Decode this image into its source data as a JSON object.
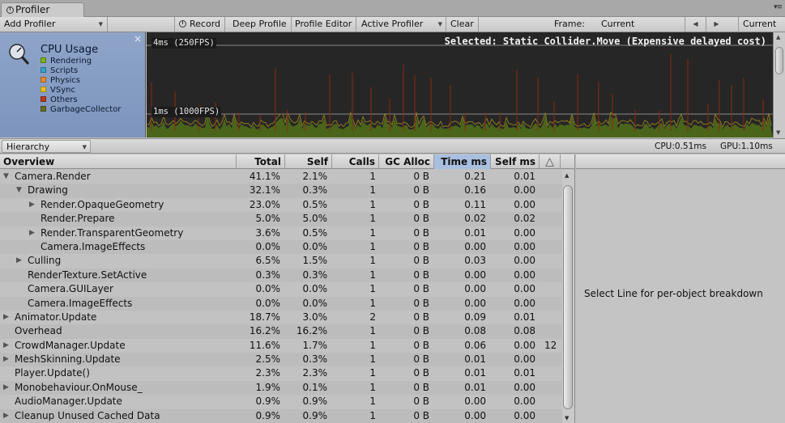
{
  "window": {
    "tab_title": "Profiler"
  },
  "toolbar": {
    "add_profiler": "Add Profiler",
    "record": "Record",
    "deep_profile": "Deep Profile",
    "profile_editor": "Profile Editor",
    "active_profiler": "Active Profiler",
    "clear": "Clear",
    "frame_label": "Frame:",
    "frame_value": "Current",
    "current_button": "Current"
  },
  "graph": {
    "area_title": "CPU Usage",
    "legend": [
      {
        "name": "Rendering",
        "color": "#7ab317"
      },
      {
        "name": "Scripts",
        "color": "#3aa1c7"
      },
      {
        "name": "Physics",
        "color": "#e88a2f"
      },
      {
        "name": "VSync",
        "color": "#e6c21e"
      },
      {
        "name": "Others",
        "color": "#b83b1a"
      },
      {
        "name": "GarbageCollector",
        "color": "#6b6b22"
      }
    ],
    "label_top": "4ms (250FPS)",
    "label_bottom": "1ms (1000FPS)",
    "selected": "Selected: Static Collider.Move (Expensive delayed cost)"
  },
  "hierarchy": {
    "mode": "Hierarchy",
    "cpu": "CPU:0.51ms",
    "gpu": "GPU:1.10ms"
  },
  "table": {
    "headers": {
      "overview": "Overview",
      "total": "Total",
      "self": "Self",
      "calls": "Calls",
      "gc_alloc": "GC Alloc",
      "time_ms": "Time ms",
      "self_ms": "Self ms"
    },
    "rows": [
      {
        "name": "Camera.Render",
        "depth": 0,
        "expander": "open",
        "total": "41.1%",
        "self": "2.1%",
        "calls": "1",
        "gc": "0 B",
        "time": "0.21",
        "selfms": "0.01",
        "warn": ""
      },
      {
        "name": "Drawing",
        "depth": 1,
        "expander": "open",
        "total": "32.1%",
        "self": "0.3%",
        "calls": "1",
        "gc": "0 B",
        "time": "0.16",
        "selfms": "0.00",
        "warn": ""
      },
      {
        "name": "Render.OpaqueGeometry",
        "depth": 2,
        "expander": "closed",
        "total": "23.0%",
        "self": "0.5%",
        "calls": "1",
        "gc": "0 B",
        "time": "0.11",
        "selfms": "0.00",
        "warn": ""
      },
      {
        "name": "Render.Prepare",
        "depth": 2,
        "expander": "none",
        "total": "5.0%",
        "self": "5.0%",
        "calls": "1",
        "gc": "0 B",
        "time": "0.02",
        "selfms": "0.02",
        "warn": ""
      },
      {
        "name": "Render.TransparentGeometry",
        "depth": 2,
        "expander": "closed",
        "total": "3.6%",
        "self": "0.5%",
        "calls": "1",
        "gc": "0 B",
        "time": "0.01",
        "selfms": "0.00",
        "warn": ""
      },
      {
        "name": "Camera.ImageEffects",
        "depth": 2,
        "expander": "none",
        "total": "0.0%",
        "self": "0.0%",
        "calls": "1",
        "gc": "0 B",
        "time": "0.00",
        "selfms": "0.00",
        "warn": ""
      },
      {
        "name": "Culling",
        "depth": 1,
        "expander": "closed",
        "total": "6.5%",
        "self": "1.5%",
        "calls": "1",
        "gc": "0 B",
        "time": "0.03",
        "selfms": "0.00",
        "warn": ""
      },
      {
        "name": "RenderTexture.SetActive",
        "depth": 1,
        "expander": "none",
        "total": "0.3%",
        "self": "0.3%",
        "calls": "1",
        "gc": "0 B",
        "time": "0.00",
        "selfms": "0.00",
        "warn": ""
      },
      {
        "name": "Camera.GUILayer",
        "depth": 1,
        "expander": "none",
        "total": "0.0%",
        "self": "0.0%",
        "calls": "1",
        "gc": "0 B",
        "time": "0.00",
        "selfms": "0.00",
        "warn": ""
      },
      {
        "name": "Camera.ImageEffects",
        "depth": 1,
        "expander": "none",
        "total": "0.0%",
        "self": "0.0%",
        "calls": "1",
        "gc": "0 B",
        "time": "0.00",
        "selfms": "0.00",
        "warn": ""
      },
      {
        "name": "Animator.Update",
        "depth": 0,
        "expander": "closed",
        "total": "18.7%",
        "self": "3.0%",
        "calls": "2",
        "gc": "0 B",
        "time": "0.09",
        "selfms": "0.01",
        "warn": ""
      },
      {
        "name": "Overhead",
        "depth": 0,
        "expander": "none",
        "total": "16.2%",
        "self": "16.2%",
        "calls": "1",
        "gc": "0 B",
        "time": "0.08",
        "selfms": "0.08",
        "warn": ""
      },
      {
        "name": "CrowdManager.Update",
        "depth": 0,
        "expander": "closed",
        "total": "11.6%",
        "self": "1.7%",
        "calls": "1",
        "gc": "0 B",
        "time": "0.06",
        "selfms": "0.00",
        "warn": "12"
      },
      {
        "name": "MeshSkinning.Update",
        "depth": 0,
        "expander": "closed",
        "total": "2.5%",
        "self": "0.3%",
        "calls": "1",
        "gc": "0 B",
        "time": "0.01",
        "selfms": "0.00",
        "warn": ""
      },
      {
        "name": "Player.Update()",
        "depth": 0,
        "expander": "none",
        "total": "2.3%",
        "self": "2.3%",
        "calls": "1",
        "gc": "0 B",
        "time": "0.01",
        "selfms": "0.01",
        "warn": ""
      },
      {
        "name": "Monobehaviour.OnMouse_",
        "depth": 0,
        "expander": "closed",
        "total": "1.9%",
        "self": "0.1%",
        "calls": "1",
        "gc": "0 B",
        "time": "0.01",
        "selfms": "0.00",
        "warn": ""
      },
      {
        "name": "AudioManager.Update",
        "depth": 0,
        "expander": "none",
        "total": "0.9%",
        "self": "0.9%",
        "calls": "1",
        "gc": "0 B",
        "time": "0.00",
        "selfms": "0.00",
        "warn": ""
      },
      {
        "name": "Cleanup Unused Cached Data",
        "depth": 0,
        "expander": "closed",
        "total": "0.9%",
        "self": "0.9%",
        "calls": "1",
        "gc": "0 B",
        "time": "0.00",
        "selfms": "0.00",
        "warn": ""
      }
    ]
  },
  "detail": {
    "message": "Select Line for per-object breakdown"
  }
}
